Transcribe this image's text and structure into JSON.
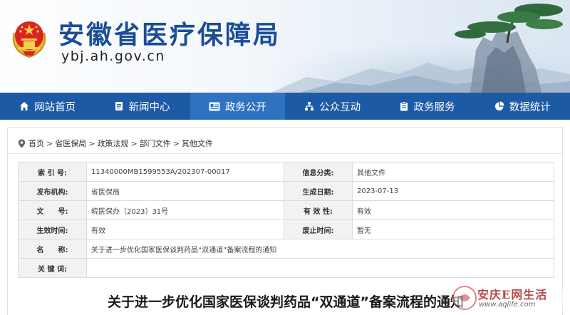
{
  "header": {
    "title": "安徽省医疗保障局",
    "domain": "ybj.ah.gov.cn"
  },
  "nav": [
    {
      "label": "网站首页",
      "icon": "home-icon"
    },
    {
      "label": "新闻中心",
      "icon": "document-icon"
    },
    {
      "label": "政务公开",
      "icon": "id-card-icon"
    },
    {
      "label": "公众互动",
      "icon": "network-icon"
    },
    {
      "label": "政务服务",
      "icon": "clipboard-icon"
    },
    {
      "label": "数据统计",
      "icon": "pie-chart-icon"
    }
  ],
  "nav_active_index": 2,
  "breadcrumb": [
    "首页",
    "省医保局",
    "政策法规",
    "部门文件",
    "其他文件"
  ],
  "breadcrumb_sep": ">",
  "meta": {
    "index_label": "索 引 号:",
    "index_value": "11340000MB1599553A/202307-00017",
    "category_label": "信息分类:",
    "category_value": "其他文件",
    "issuer_label": "发布机构:",
    "issuer_value": "省医保局",
    "date_label": "生成日期:",
    "date_value": "2023-07-13",
    "docno_label": "文　　号:",
    "docno_value": "皖医保办〔2023〕31号",
    "validity_label": "有 效 性:",
    "validity_value": "有效",
    "effective_label": "生效时间:",
    "effective_value": "有效",
    "repeal_label": "废止时间:",
    "repeal_value": "暂无",
    "name_label": "名　　称:",
    "name_value": "关于进一步优化国家医保谈判药品“双通道”备案流程的通知",
    "keywords_label": "关 键 词:",
    "keywords_value": ""
  },
  "document_title": "关于进一步优化国家医保谈判药品“双通道”备案流程的通知",
  "watermark": {
    "text": "安庆E网生活",
    "url": "www.aqlife.com"
  },
  "colors": {
    "brand_blue": "#1b4d98",
    "nav_bg": "#1d5aa5",
    "nav_active": "#2f73c0"
  }
}
